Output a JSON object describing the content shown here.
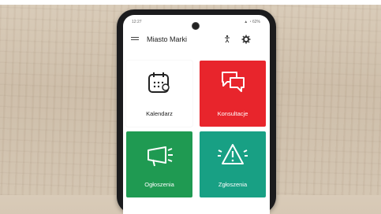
{
  "statusbar": {
    "time": "12:27",
    "right": "▲ ◔ 62%"
  },
  "appbar": {
    "title": "Miasto Marki"
  },
  "tiles": [
    {
      "label": "Kalendarz",
      "color": "#ffffff"
    },
    {
      "label": "Konsultacje",
      "color": "#e8252c"
    },
    {
      "label": "Ogłoszenia",
      "color": "#1f9a52"
    },
    {
      "label": "Zgłoszenia",
      "color": "#18a084"
    }
  ],
  "icons": [
    "menu-icon",
    "accessibility-icon",
    "gear-icon",
    "calendar-icon",
    "chat-bubbles-icon",
    "megaphone-icon",
    "alert-triangle-icon"
  ]
}
